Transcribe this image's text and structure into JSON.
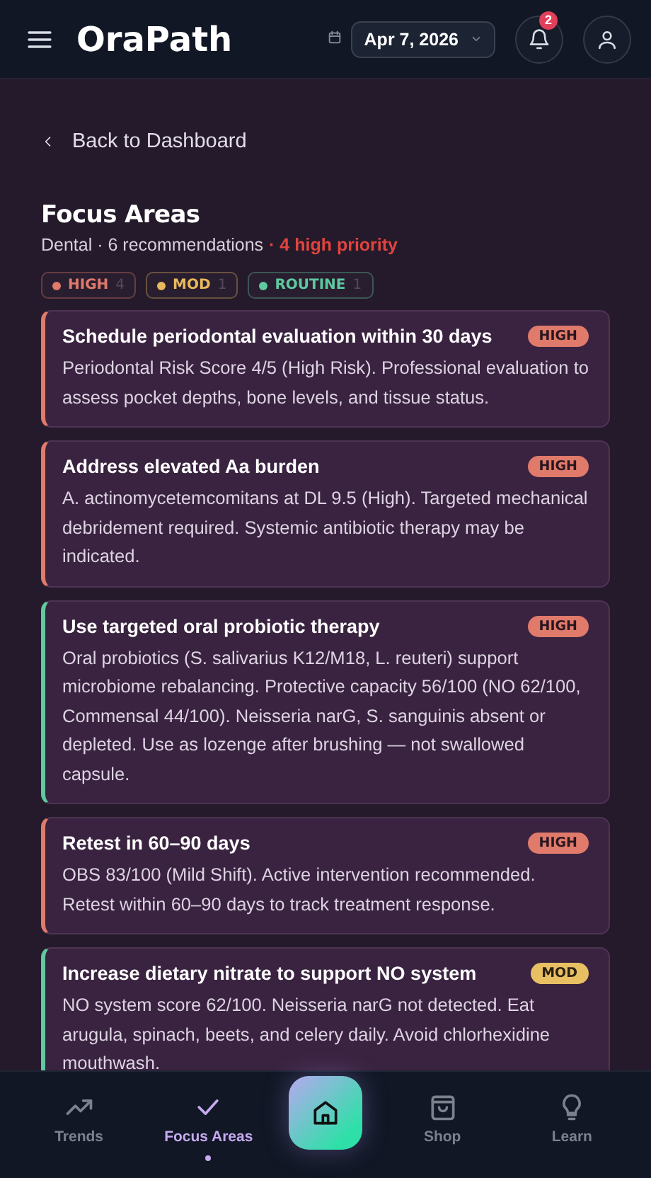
{
  "header": {
    "logo": "OraPath",
    "date": "Apr 7, 2026",
    "notification_count": "2"
  },
  "back_link": "Back to Dashboard",
  "title": "Focus Areas",
  "summary": "Dental · 6 recommendations",
  "priority_note": "· 4 high priority",
  "filters": [
    {
      "label": "HIGH",
      "count": "4",
      "color": "#e07a6a"
    },
    {
      "label": "MOD",
      "count": "1",
      "color": "#e8b95c"
    },
    {
      "label": "ROUTINE",
      "count": "1",
      "color": "#5fc9a0"
    }
  ],
  "cards": [
    {
      "title": "Schedule periodontal evaluation within 30 days",
      "badge": "HIGH",
      "kind": "high",
      "color": "#e07a6a",
      "body": "Periodontal Risk Score 4/5 (High Risk). Professional evaluation to assess pocket depths, bone levels, and tissue status."
    },
    {
      "title": "Address elevated Aa burden",
      "badge": "HIGH",
      "kind": "high",
      "color": "#e07a6a",
      "body": "A. actinomycetemcomitans at DL 9.5 (High). Targeted mechanical debridement required. Systemic antibiotic therapy may be indicated."
    },
    {
      "title": "Use targeted oral probiotic therapy",
      "badge": "HIGH",
      "kind": "high",
      "color": "#5fc9a0",
      "body": "Oral probiotics (S. salivarius K12/M18, L. reuteri) support microbiome rebalancing. Protective capacity 56/100 (NO 62/100, Commensal 44/100). Neisseria narG, S. sanguinis absent or depleted. Use as lozenge after brushing — not swallowed capsule."
    },
    {
      "title": "Retest in 60–90 days",
      "badge": "HIGH",
      "kind": "high",
      "color": "#e07a6a",
      "body": "OBS 83/100 (Mild Shift). Active intervention recommended. Retest within 60–90 days to track treatment response."
    },
    {
      "title": "Increase dietary nitrate to support NO system",
      "badge": "MOD",
      "kind": "mod",
      "color": "#5fc9a0",
      "body": "NO system score 62/100. Neisseria narG not detected. Eat arugula, spinach, beets, and celery daily. Avoid chlorhexidine mouthwash."
    }
  ],
  "nav": [
    {
      "label": "Trends",
      "selected": false
    },
    {
      "label": "Focus Areas",
      "selected": true
    },
    {
      "label": "Shop",
      "selected": false
    },
    {
      "label": "Learn",
      "selected": false
    }
  ]
}
